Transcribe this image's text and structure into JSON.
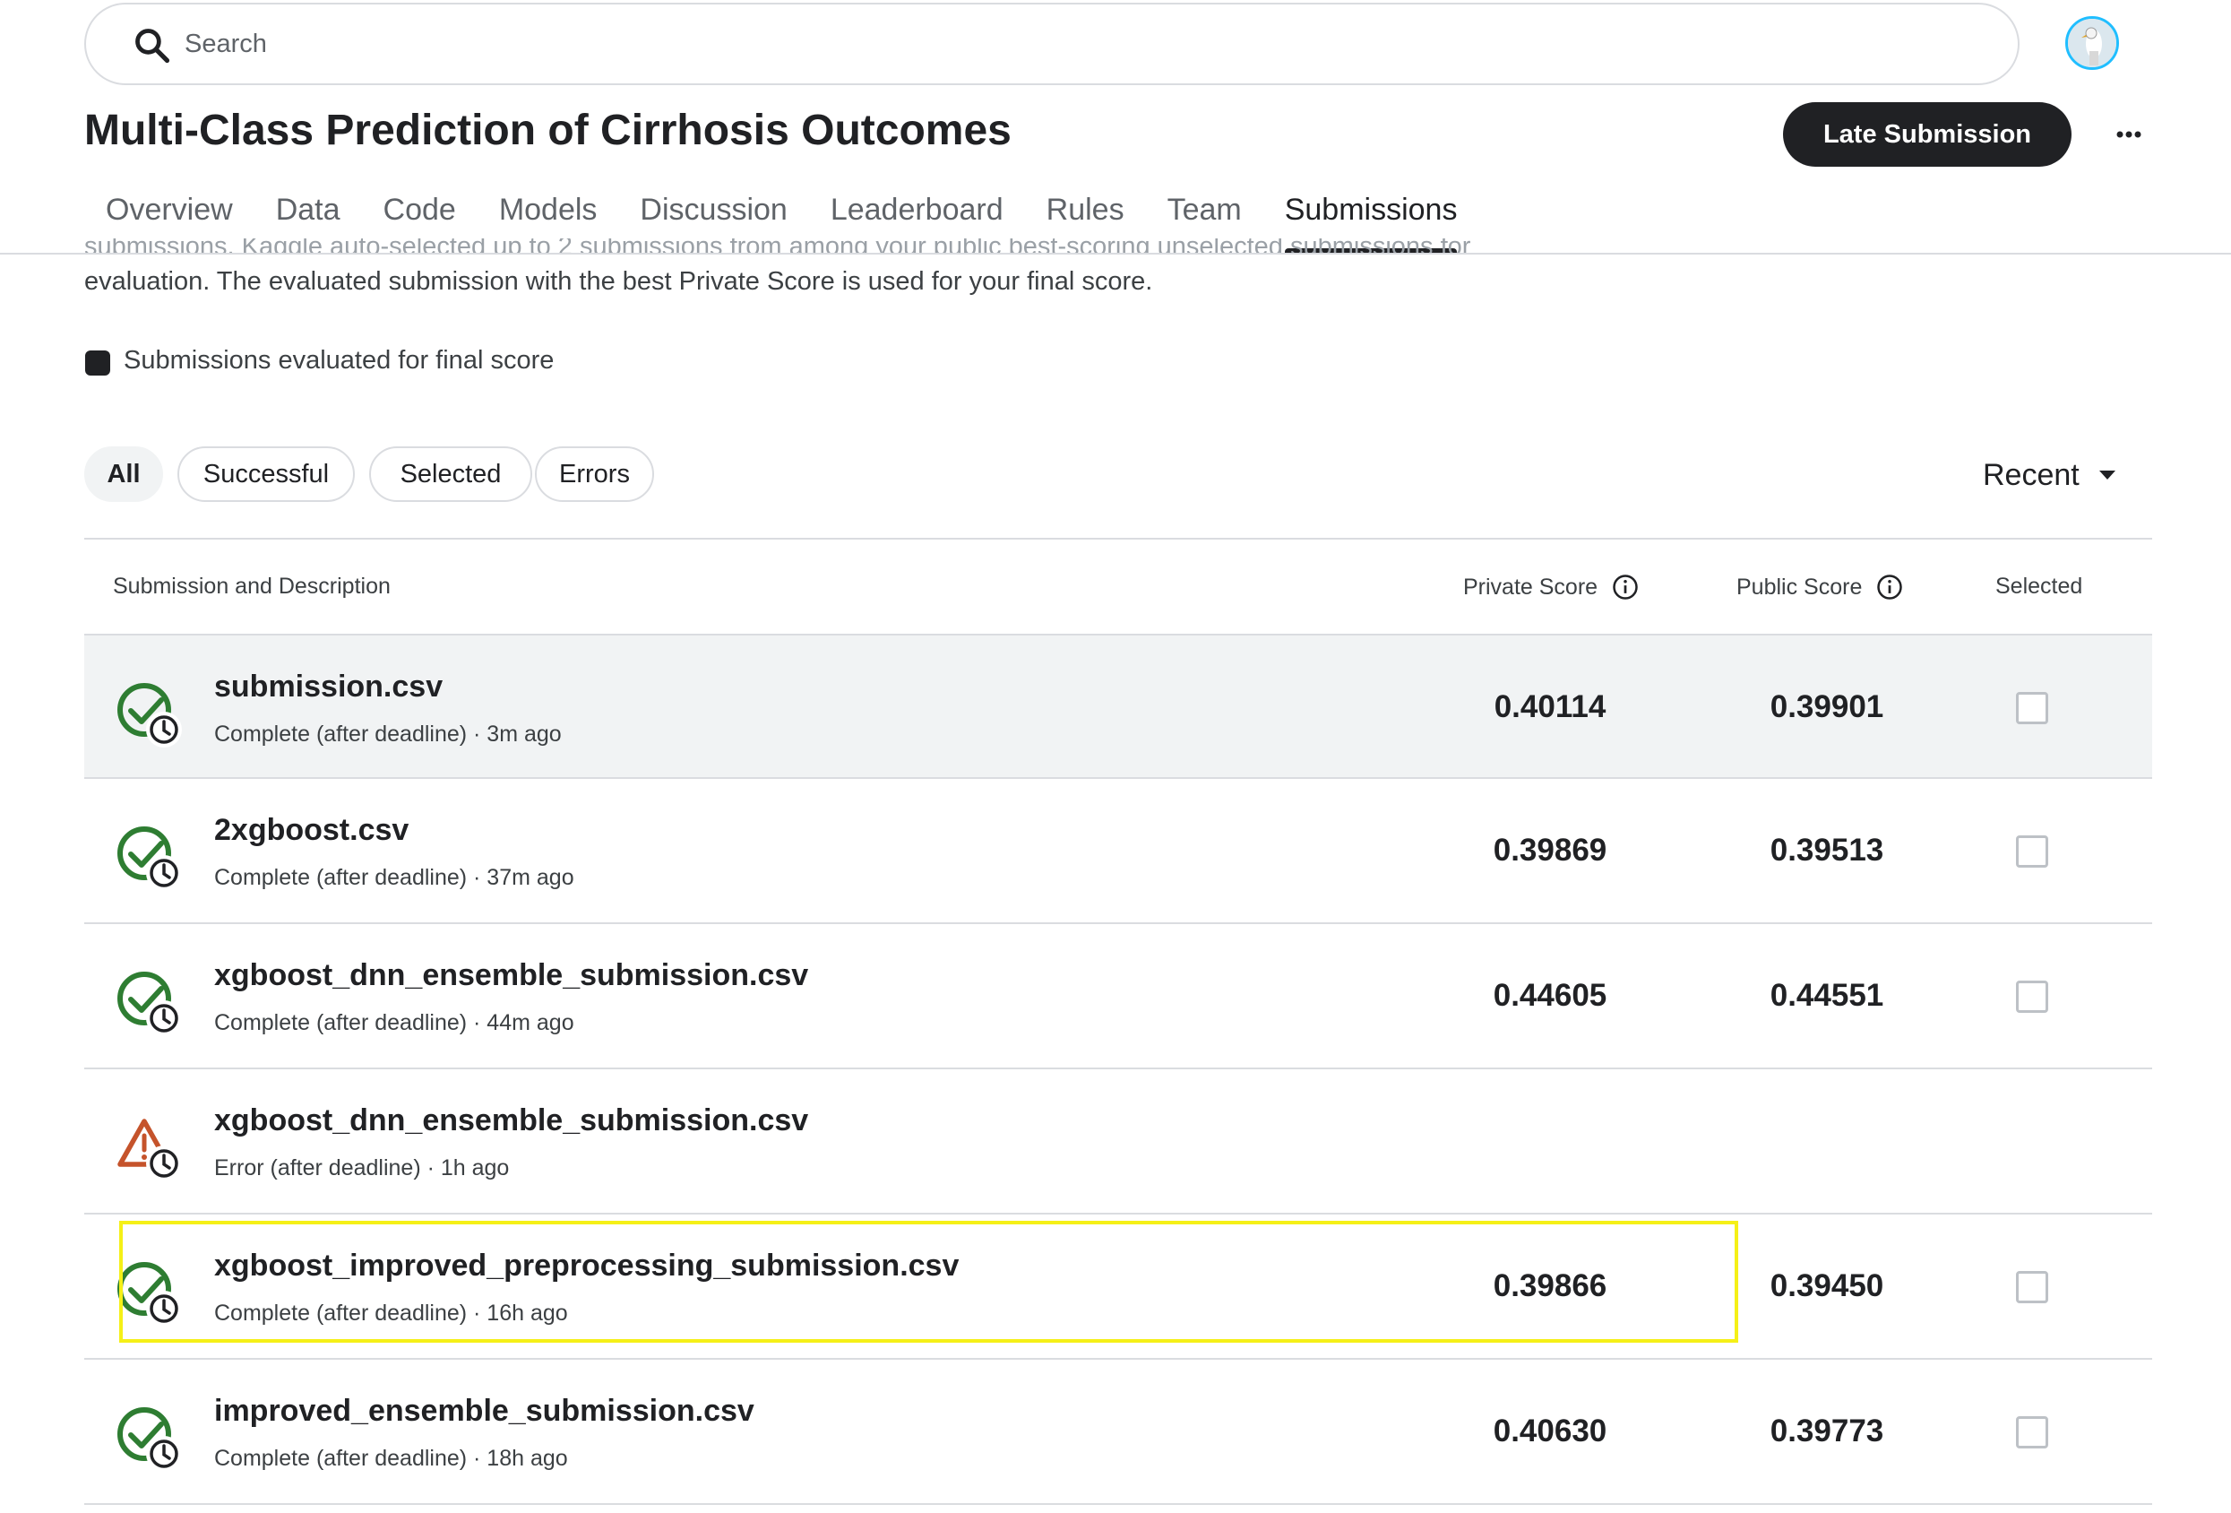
{
  "search": {
    "placeholder": "Search"
  },
  "header": {
    "title": "Multi-Class Prediction of Cirrhosis Outcomes",
    "late_submission_label": "Late Submission",
    "more_label": "···"
  },
  "tabs": [
    {
      "label": "Overview"
    },
    {
      "label": "Data"
    },
    {
      "label": "Code"
    },
    {
      "label": "Models"
    },
    {
      "label": "Discussion"
    },
    {
      "label": "Leaderboard"
    },
    {
      "label": "Rules"
    },
    {
      "label": "Team"
    },
    {
      "label": "Submissions",
      "active": true
    }
  ],
  "info": {
    "clipped_line": "submissions, Kaggle auto-selected up to 2 submissions from among your public best-scoring unselected submissions for",
    "description": "evaluation. The evaluated submission with the best Private Score is used for your final score.",
    "legend": "Submissions evaluated for final score"
  },
  "filters": [
    {
      "label": "All",
      "active": true
    },
    {
      "label": "Successful"
    },
    {
      "label": "Selected"
    },
    {
      "label": "Errors"
    }
  ],
  "sort": {
    "label": "Recent"
  },
  "table": {
    "headers": {
      "submission": "Submission and Description",
      "private": "Private Score",
      "public": "Public Score",
      "selected": "Selected"
    },
    "rows": [
      {
        "name": "submission.csv",
        "status": "Complete (after deadline) · 3m ago",
        "private": "0.40114",
        "public": "0.39901",
        "ok": true
      },
      {
        "name": "2xgboost.csv",
        "status": "Complete (after deadline) · 37m ago",
        "private": "0.39869",
        "public": "0.39513",
        "ok": true
      },
      {
        "name": "xgboost_dnn_ensemble_submission.csv",
        "status": "Complete (after deadline) · 44m ago",
        "private": "0.44605",
        "public": "0.44551",
        "ok": true
      },
      {
        "name": "xgboost_dnn_ensemble_submission.csv",
        "status": "Error (after deadline) · 1h ago",
        "private": "",
        "public": "",
        "ok": false
      },
      {
        "name": "xgboost_improved_preprocessing_submission.csv",
        "status": "Complete (after deadline) · 16h ago",
        "private": "0.39866",
        "public": "0.39450",
        "ok": true
      },
      {
        "name": "improved_ensemble_submission.csv",
        "status": "Complete (after deadline) · 18h ago",
        "private": "0.40630",
        "public": "0.39773",
        "ok": true
      }
    ]
  },
  "colors": {
    "success": "#2e7d32",
    "error": "#c5532b",
    "highlight": "#f5f017",
    "avatar_ring": "#20beff"
  }
}
